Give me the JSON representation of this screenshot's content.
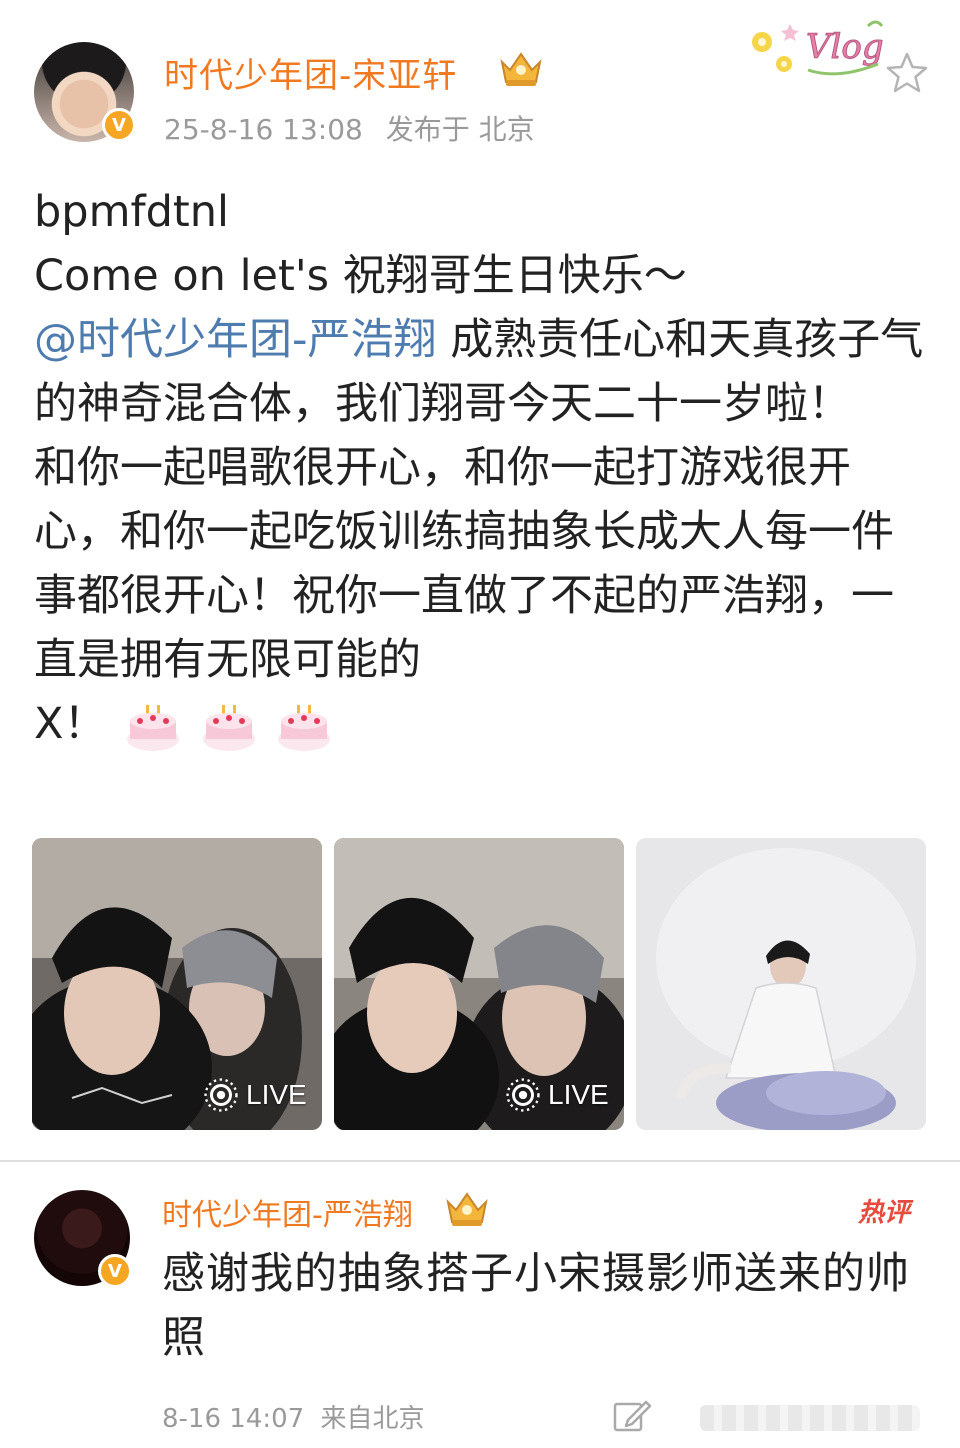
{
  "post": {
    "author": "时代少年团-宋亚轩",
    "timestamp": "25-8-16 13:08",
    "location": "发布于 北京",
    "sticker_text": "Vlog",
    "lines": [
      "bpmfdtnl",
      "Come on let's 祝翔哥生日快乐～"
    ],
    "mention": "@时代少年团-严浩翔",
    "body_after_mention": " 成熟责任心和天真孩子气的神奇混合体，我们翔哥今天二十一岁啦！",
    "body_paragraph": "和你一起唱歌很开心，和你一起打游戏很开心，和你一起吃饭训练搞抽象长成大人每一件事都很开心！祝你一直做了不起的严浩翔，一直是拥有无限可能的",
    "body_tail": "X！",
    "emoji": [
      "cake-icon",
      "cake-icon",
      "cake-icon"
    ],
    "images": [
      {
        "live_label": "LIVE"
      },
      {
        "live_label": "LIVE"
      },
      {
        "live_label": ""
      }
    ]
  },
  "comment": {
    "author": "时代少年团-严浩翔",
    "hot_label": "热评",
    "text": "感谢我的抽象搭子小宋摄影师送来的帅照",
    "date": "8-16 14:07",
    "source": "来自北京"
  },
  "colors": {
    "username": "#f07a22",
    "mention": "#4f7cae",
    "meta": "#9a9a9a",
    "hot": "#e74a3c",
    "verified": "#f5a623"
  }
}
